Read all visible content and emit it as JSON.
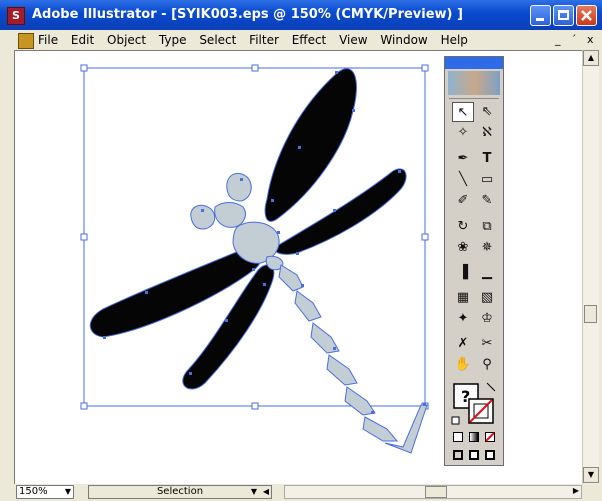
{
  "window": {
    "title": "Adobe Illustrator - [SYIK003.eps @ 150% (CMYK/Preview) ]"
  },
  "menubar": {
    "items": [
      "File",
      "Edit",
      "Object",
      "Type",
      "Select",
      "Filter",
      "Effect",
      "View",
      "Window",
      "Help"
    ],
    "doc_controls": [
      "_",
      "´",
      "x"
    ]
  },
  "toolbox": {
    "tools": [
      {
        "icon": "selection-arrow-icon",
        "glyph": "↖"
      },
      {
        "icon": "direct-selection-arrow-icon",
        "glyph": "⇖"
      },
      {
        "icon": "magic-wand-icon",
        "glyph": "✧"
      },
      {
        "icon": "lasso-icon",
        "glyph": "ℵ"
      },
      {
        "icon": "pen-icon",
        "glyph": "✒"
      },
      {
        "icon": "type-icon",
        "glyph": "T"
      },
      {
        "icon": "line-icon",
        "glyph": "╲"
      },
      {
        "icon": "rectangle-icon",
        "glyph": "▭"
      },
      {
        "icon": "paintbrush-icon",
        "glyph": "✐"
      },
      {
        "icon": "pencil-icon",
        "glyph": "✎"
      },
      {
        "icon": "rotate-icon",
        "glyph": "↻"
      },
      {
        "icon": "scale-icon",
        "glyph": "⧉"
      },
      {
        "icon": "warp-icon",
        "glyph": "❀"
      },
      {
        "icon": "symbol-sprayer-icon",
        "glyph": "✵"
      },
      {
        "icon": "graph-column-icon",
        "glyph": "▐"
      },
      {
        "icon": "graph-bar-icon",
        "glyph": "▁"
      },
      {
        "icon": "mesh-icon",
        "glyph": "▦"
      },
      {
        "icon": "gradient-icon",
        "glyph": "▧"
      },
      {
        "icon": "eyedropper-icon",
        "glyph": "✦"
      },
      {
        "icon": "paint-bucket-icon",
        "glyph": "♔"
      },
      {
        "icon": "slice-icon",
        "glyph": "✗"
      },
      {
        "icon": "scissors-icon",
        "glyph": "✂"
      },
      {
        "icon": "hand-icon",
        "glyph": "✋"
      },
      {
        "icon": "zoom-icon",
        "glyph": "⚲"
      }
    ]
  },
  "statusbar": {
    "zoom": "150%",
    "tool": "Selection"
  },
  "colors": {
    "titlebar": "#0b4bd0",
    "body_fill": "#c2cdd4",
    "wing_fill": "#050505",
    "selection": "#4a6ee0",
    "none_slash": "#e0101a"
  }
}
